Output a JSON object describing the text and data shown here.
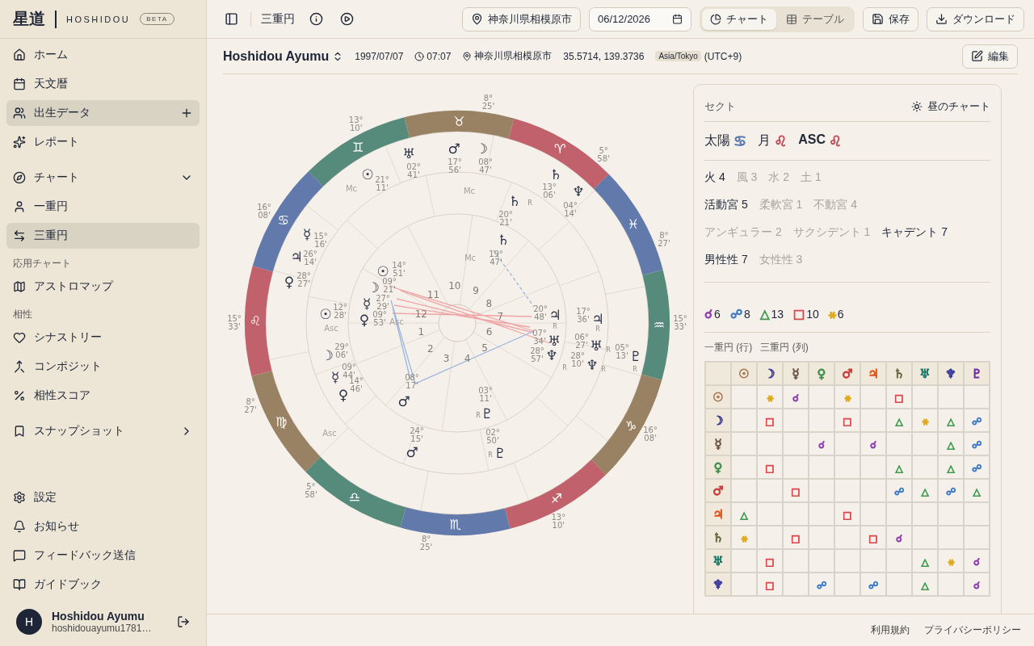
{
  "sidebar": {
    "logo": "星道",
    "brand": "HOSHIDOU",
    "badge": "BETA",
    "nav": [
      {
        "kind": "link",
        "label": "ホーム",
        "selected": false
      },
      {
        "kind": "link",
        "label": "天文暦",
        "selected": false
      },
      {
        "kind": "link_add",
        "label": "出生データ",
        "selected": true
      },
      {
        "kind": "link",
        "label": "レポート",
        "selected": false
      },
      {
        "kind": "group",
        "label": "チャート",
        "expanded": true
      },
      {
        "kind": "link",
        "label": "一重円",
        "selected": false
      },
      {
        "kind": "link",
        "label": "三重円",
        "selected": true
      },
      {
        "kind": "section",
        "label": "応用チャート"
      },
      {
        "kind": "link",
        "label": "アストロマップ",
        "selected": false
      },
      {
        "kind": "section",
        "label": "相性"
      },
      {
        "kind": "link",
        "label": "シナストリー",
        "selected": false
      },
      {
        "kind": "link",
        "label": "コンポジット",
        "selected": false
      },
      {
        "kind": "link",
        "label": "相性スコア",
        "selected": false
      },
      {
        "kind": "group",
        "label": "スナップショット",
        "expanded": false
      }
    ],
    "bottom_nav": [
      "設定",
      "お知らせ",
      "フィードバック送信",
      "ガイドブック"
    ],
    "user": {
      "avatar": "H",
      "name": "Hoshidou Ayumu",
      "email": "hoshidouayumu1781…"
    }
  },
  "toolbar": {
    "title": "三重円",
    "location": "神奈川県相模原市",
    "date": "06/12/2026",
    "views": [
      {
        "label": "チャート",
        "selected": true
      },
      {
        "label": "テーブル",
        "selected": false
      }
    ],
    "actions": [
      "保存",
      "ダウンロード"
    ]
  },
  "person": {
    "name": "Hoshidou Ayumu",
    "date": "1997/07/07",
    "time": "07:07",
    "place": "神奈川県相模原市",
    "coords": "35.5714, 139.3736",
    "timezone": "Asia/Tokyo",
    "offset": "(UTC+9)",
    "edit": "編集"
  },
  "wheel": {
    "signs": [
      {
        "glyph": "♈",
        "color": "#c0616b"
      },
      {
        "glyph": "♉",
        "color": "#998163"
      },
      {
        "glyph": "♊",
        "color": "#568a7b"
      },
      {
        "glyph": "♋",
        "color": "#627aab"
      },
      {
        "glyph": "♌",
        "color": "#c0616b"
      },
      {
        "glyph": "♍",
        "color": "#998163"
      },
      {
        "glyph": "♎",
        "color": "#568a7b"
      },
      {
        "glyph": "♏",
        "color": "#627aab"
      },
      {
        "glyph": "♐",
        "color": "#c0616b"
      },
      {
        "glyph": "♑",
        "color": "#998163"
      },
      {
        "glyph": "♒",
        "color": "#568a7b"
      },
      {
        "glyph": "♓",
        "color": "#627aab"
      }
    ],
    "cusps": [
      {
        "deg": "15°",
        "min": "33'"
      },
      {
        "deg": "8°",
        "min": "27'"
      },
      {
        "deg": "5°",
        "min": "58'"
      },
      {
        "deg": "8°",
        "min": "25'"
      },
      {
        "deg": "13°",
        "min": "10'"
      },
      {
        "deg": "16°",
        "min": "08'"
      },
      {
        "deg": "15°",
        "min": "33'"
      },
      {
        "deg": "8°",
        "min": "27'"
      },
      {
        "deg": "5°",
        "min": "58'"
      },
      {
        "deg": "8°",
        "min": "25'"
      },
      {
        "deg": "13°",
        "min": "10'"
      },
      {
        "deg": "16°",
        "min": "08'"
      }
    ],
    "angle_labels": [
      "Mc",
      "Asc",
      "Mc",
      "Asc",
      "Mc",
      "Asc"
    ],
    "house_numbers": [
      "1",
      "2",
      "3",
      "4",
      "5",
      "6",
      "7",
      "8",
      "9",
      "10",
      "11",
      "12"
    ],
    "rings": [
      {
        "planets": [
          {
            "glyph": "☉",
            "deg": "14°",
            "min": "51'"
          },
          {
            "glyph": "☽",
            "deg": "09°",
            "min": "21'"
          },
          {
            "glyph": "☿",
            "deg": "27°",
            "min": "29'"
          },
          {
            "glyph": "♀",
            "deg": "09°",
            "min": "53'"
          },
          {
            "glyph": "♂",
            "deg": "08°",
            "min": "17'"
          },
          {
            "glyph": "♃",
            "deg": "20°",
            "min": "48'",
            "retrograde": "R"
          },
          {
            "glyph": "♄",
            "deg": "19°",
            "min": "47'"
          },
          {
            "glyph": "♅",
            "deg": "07°",
            "min": "34'"
          },
          {
            "glyph": "♆",
            "deg": "28°",
            "min": "57'",
            "retrograde": "R"
          },
          {
            "glyph": "♇",
            "deg": "03°",
            "min": "11'",
            "retrograde": "R"
          }
        ]
      },
      {
        "planets": [
          {
            "glyph": "☉",
            "deg": "12°",
            "min": "28'"
          },
          {
            "glyph": "☽",
            "deg": "29°",
            "min": "06'"
          },
          {
            "glyph": "☿",
            "deg": "09°",
            "min": "44'"
          },
          {
            "glyph": "♀",
            "deg": "14°",
            "min": "46'"
          },
          {
            "glyph": "♂",
            "deg": "24°",
            "min": "15'"
          },
          {
            "glyph": "♃",
            "deg": "17°",
            "min": "36'",
            "retrograde": "R"
          },
          {
            "glyph": "♄",
            "deg": "20°",
            "min": "21'",
            "retrograde": "R"
          },
          {
            "glyph": "♅",
            "deg": "06°",
            "min": "27'",
            "retrograde": "R"
          },
          {
            "glyph": "♆",
            "deg": "28°",
            "min": "10'",
            "retrograde": "R"
          },
          {
            "glyph": "♇",
            "deg": "02°",
            "min": "50'",
            "retrograde": "R"
          }
        ]
      },
      {
        "planets": [
          {
            "glyph": "☉",
            "deg": "21°",
            "min": "11'"
          },
          {
            "glyph": "☽",
            "deg": "08°",
            "min": "47'"
          },
          {
            "glyph": "☿",
            "deg": "15°",
            "min": "16'"
          },
          {
            "glyph": "♀",
            "deg": "28°",
            "min": "27'"
          },
          {
            "glyph": "♂",
            "deg": "17°",
            "min": "56'"
          },
          {
            "glyph": "♃",
            "deg": "26°",
            "min": "14'"
          },
          {
            "glyph": "♄",
            "deg": "13°",
            "min": "06'"
          },
          {
            "glyph": "♅",
            "deg": "02°",
            "min": "41'"
          },
          {
            "glyph": "♆",
            "deg": "04°",
            "min": "14'"
          },
          {
            "glyph": "♇",
            "deg": "05°",
            "min": "13'",
            "retrograde": "R"
          }
        ]
      }
    ]
  },
  "panel": {
    "sect": {
      "label": "セクト",
      "value": "昼のチャート"
    },
    "placements": [
      {
        "label": "太陽",
        "glyph": "♋",
        "color": "#5a78b0"
      },
      {
        "label": "月",
        "glyph": "♌",
        "color": "#c0505e"
      },
      {
        "label": "ASC",
        "glyph": "♌",
        "color": "#c0505e"
      }
    ],
    "stats": [
      {
        "items": [
          {
            "text": "火 4",
            "highlighted": true
          },
          {
            "text": "風 3",
            "highlighted": false
          },
          {
            "text": "水 2",
            "highlighted": false
          },
          {
            "text": "土 1",
            "highlighted": false
          }
        ]
      },
      {
        "items": [
          {
            "text": "活動宮 5",
            "highlighted": true
          },
          {
            "text": "柔軟宮 1",
            "highlighted": false
          },
          {
            "text": "不動宮 4",
            "highlighted": false
          }
        ]
      },
      {
        "items": [
          {
            "text": "アンギュラー 2",
            "highlighted": false
          },
          {
            "text": "サクシデント 1",
            "highlighted": false
          },
          {
            "text": "キャデント 7",
            "highlighted": true
          }
        ]
      },
      {
        "items": [
          {
            "text": "男性性 7",
            "highlighted": true
          },
          {
            "text": "女性性 3",
            "highlighted": false
          }
        ]
      }
    ],
    "aspect_counts": [
      {
        "glyph": "☌",
        "count": "6",
        "color": "#8e3cb0"
      },
      {
        "glyph": "☍",
        "count": "8",
        "color": "#3a78c8"
      },
      {
        "glyph": "△",
        "count": "13",
        "color": "#3f9a4e"
      },
      {
        "glyph": "□",
        "count": "10",
        "color": "#d9484f"
      },
      {
        "glyph": "⚹",
        "count": "6",
        "color": "#e0aa20"
      }
    ],
    "grid_caption": [
      "一重円 (行)",
      "三重円 (列)"
    ],
    "grid": {
      "columns": [
        {
          "glyph": "☉",
          "color": "#a87a5a"
        },
        {
          "glyph": "☽",
          "color": "#3b3f9c"
        },
        {
          "glyph": "☿",
          "color": "#6b5848"
        },
        {
          "glyph": "♀",
          "color": "#3f8f4a"
        },
        {
          "glyph": "♂",
          "color": "#c83c3c"
        },
        {
          "glyph": "♃",
          "color": "#e0561a"
        },
        {
          "glyph": "♄",
          "color": "#6b6b48"
        },
        {
          "glyph": "♅",
          "color": "#1a7a6a"
        },
        {
          "glyph": "♆",
          "color": "#3a3a9a"
        },
        {
          "glyph": "♇",
          "color": "#6a2aa0"
        }
      ],
      "rows": [
        {
          "glyph": "☉",
          "color": "#a87a5a",
          "cells": [
            null,
            {
              "glyph": "⚹",
              "color": "#e0aa20"
            },
            {
              "glyph": "☌",
              "color": "#8e3cb0"
            },
            null,
            {
              "glyph": "⚹",
              "color": "#e0aa20"
            },
            null,
            {
              "glyph": "□",
              "color": "#d9484f"
            },
            null,
            null,
            null
          ]
        },
        {
          "glyph": "☽",
          "color": "#3b3f9c",
          "cells": [
            null,
            {
              "glyph": "□",
              "color": "#d9484f"
            },
            null,
            null,
            {
              "glyph": "□",
              "color": "#d9484f"
            },
            null,
            {
              "glyph": "△",
              "color": "#3f9a4e"
            },
            {
              "glyph": "⚹",
              "color": "#e0aa20"
            },
            {
              "glyph": "△",
              "color": "#3f9a4e"
            },
            {
              "glyph": "☍",
              "color": "#3a78c8"
            }
          ]
        },
        {
          "glyph": "☿",
          "color": "#6b5848",
          "cells": [
            null,
            null,
            null,
            {
              "glyph": "☌",
              "color": "#8e3cb0"
            },
            null,
            {
              "glyph": "☌",
              "color": "#8e3cb0"
            },
            null,
            null,
            {
              "glyph": "△",
              "color": "#3f9a4e"
            },
            {
              "glyph": "☍",
              "color": "#3a78c8"
            }
          ]
        },
        {
          "glyph": "♀",
          "color": "#3f8f4a",
          "cells": [
            null,
            {
              "glyph": "□",
              "color": "#d9484f"
            },
            null,
            null,
            null,
            null,
            {
              "glyph": "△",
              "color": "#3f9a4e"
            },
            null,
            {
              "glyph": "△",
              "color": "#3f9a4e"
            },
            {
              "glyph": "☍",
              "color": "#3a78c8"
            }
          ]
        },
        {
          "glyph": "♂",
          "color": "#c83c3c",
          "cells": [
            null,
            null,
            {
              "glyph": "□",
              "color": "#d9484f"
            },
            null,
            null,
            null,
            {
              "glyph": "☍",
              "color": "#3a78c8"
            },
            {
              "glyph": "△",
              "color": "#3f9a4e"
            },
            {
              "glyph": "☍",
              "color": "#3a78c8"
            },
            {
              "glyph": "△",
              "color": "#3f9a4e"
            }
          ]
        },
        {
          "glyph": "♃",
          "color": "#e0561a",
          "cells": [
            {
              "glyph": "△",
              "color": "#3f9a4e"
            },
            null,
            null,
            null,
            {
              "glyph": "□",
              "color": "#d9484f"
            },
            null,
            null,
            null,
            null,
            null
          ]
        },
        {
          "glyph": "♄",
          "color": "#6b6b48",
          "cells": [
            {
              "glyph": "⚹",
              "color": "#e0aa20"
            },
            null,
            {
              "glyph": "□",
              "color": "#d9484f"
            },
            null,
            null,
            {
              "glyph": "□",
              "color": "#d9484f"
            },
            {
              "glyph": "☌",
              "color": "#8e3cb0"
            },
            null,
            null,
            null
          ]
        },
        {
          "glyph": "♅",
          "color": "#1a7a6a",
          "cells": [
            null,
            {
              "glyph": "□",
              "color": "#d9484f"
            },
            null,
            null,
            null,
            null,
            null,
            {
              "glyph": "△",
              "color": "#3f9a4e"
            },
            {
              "glyph": "⚹",
              "color": "#e0aa20"
            },
            {
              "glyph": "☌",
              "color": "#8e3cb0"
            }
          ]
        },
        {
          "glyph": "♆",
          "color": "#3a3a9a",
          "cells": [
            null,
            {
              "glyph": "□",
              "color": "#d9484f"
            },
            null,
            {
              "glyph": "☍",
              "color": "#3a78c8"
            },
            null,
            {
              "glyph": "☍",
              "color": "#3a78c8"
            },
            null,
            {
              "glyph": "△",
              "color": "#3f9a4e"
            },
            null,
            {
              "glyph": "☌",
              "color": "#8e3cb0"
            }
          ]
        }
      ]
    }
  },
  "footer": [
    "利用規約",
    "プライバシーポリシー"
  ]
}
